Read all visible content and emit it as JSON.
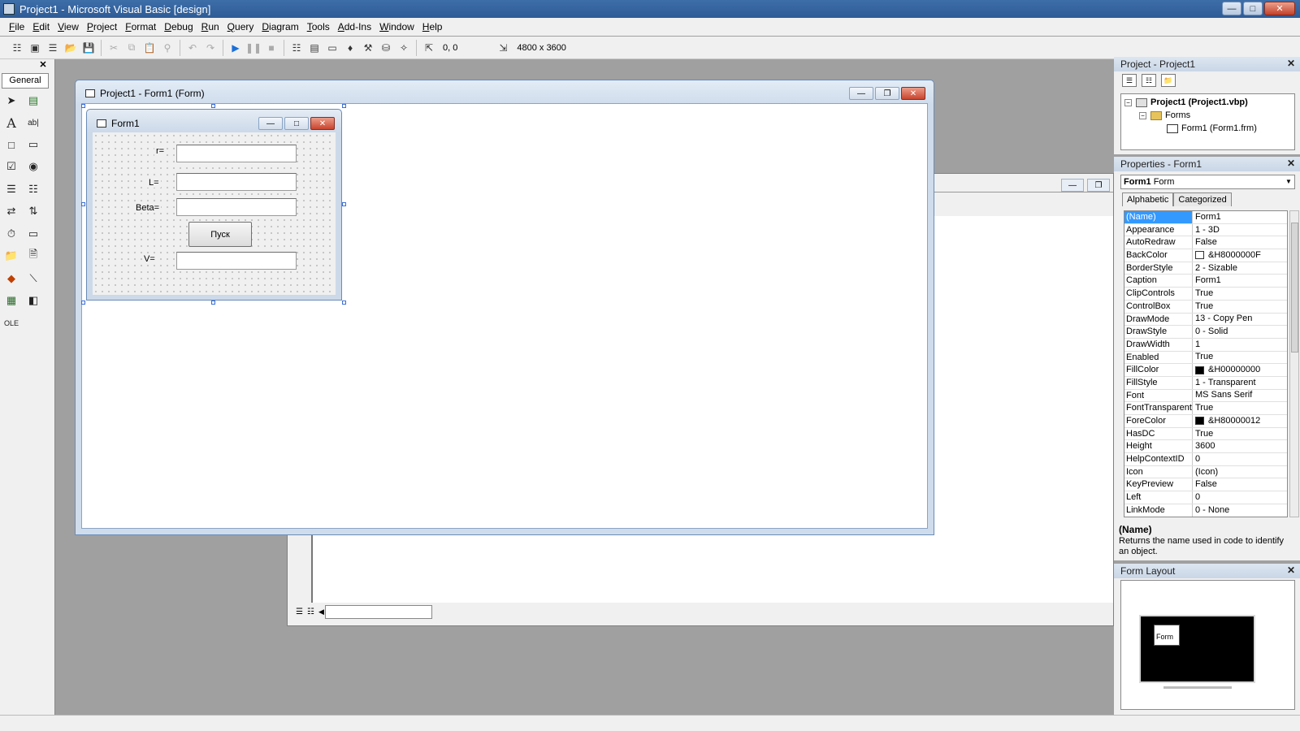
{
  "app": {
    "title": "Project1 - Microsoft Visual Basic [design]"
  },
  "menu": [
    "File",
    "Edit",
    "View",
    "Project",
    "Format",
    "Debug",
    "Run",
    "Query",
    "Diagram",
    "Tools",
    "Add-Ins",
    "Window",
    "Help"
  ],
  "toolbar": {
    "position": "0, 0",
    "size": "4800 x 3600"
  },
  "toolbox": {
    "tab": "General"
  },
  "designer": {
    "title": "Project1 - Form1 (Form)"
  },
  "form": {
    "title": "Form1",
    "labels": {
      "r": "r=",
      "l": "L=",
      "beta": "Beta=",
      "v": "V="
    },
    "button": "Пуск"
  },
  "project_panel": {
    "title": "Project - Project1",
    "tree": {
      "root": "Project1 (Project1.vbp)",
      "folder": "Forms",
      "item": "Form1 (Form1.frm)"
    }
  },
  "properties_panel": {
    "title": "Properties - Form1",
    "object_name": "Form1",
    "object_type": "Form",
    "tabs": [
      "Alphabetic",
      "Categorized"
    ],
    "rows": [
      {
        "name": "(Name)",
        "value": "Form1"
      },
      {
        "name": "Appearance",
        "value": "1 - 3D"
      },
      {
        "name": "AutoRedraw",
        "value": "False"
      },
      {
        "name": "BackColor",
        "value": "&H8000000F",
        "swatch": "#ffffff"
      },
      {
        "name": "BorderStyle",
        "value": "2 - Sizable"
      },
      {
        "name": "Caption",
        "value": "Form1"
      },
      {
        "name": "ClipControls",
        "value": "True"
      },
      {
        "name": "ControlBox",
        "value": "True"
      },
      {
        "name": "DrawMode",
        "value": "13 - Copy Pen"
      },
      {
        "name": "DrawStyle",
        "value": "0 - Solid"
      },
      {
        "name": "DrawWidth",
        "value": "1"
      },
      {
        "name": "Enabled",
        "value": "True"
      },
      {
        "name": "FillColor",
        "value": "&H00000000",
        "swatch": "#000000"
      },
      {
        "name": "FillStyle",
        "value": "1 - Transparent"
      },
      {
        "name": "Font",
        "value": "MS Sans Serif"
      },
      {
        "name": "FontTransparent",
        "value": "True"
      },
      {
        "name": "ForeColor",
        "value": "&H80000012",
        "swatch": "#000000"
      },
      {
        "name": "HasDC",
        "value": "True"
      },
      {
        "name": "Height",
        "value": "3600"
      },
      {
        "name": "HelpContextID",
        "value": "0"
      },
      {
        "name": "Icon",
        "value": "(Icon)"
      },
      {
        "name": "KeyPreview",
        "value": "False"
      },
      {
        "name": "Left",
        "value": "0"
      },
      {
        "name": "LinkMode",
        "value": "0 - None"
      }
    ],
    "description_title": "(Name)",
    "description": "Returns the name used in code to identify an object."
  },
  "layout_panel": {
    "title": "Form Layout",
    "form_label": "Form"
  }
}
